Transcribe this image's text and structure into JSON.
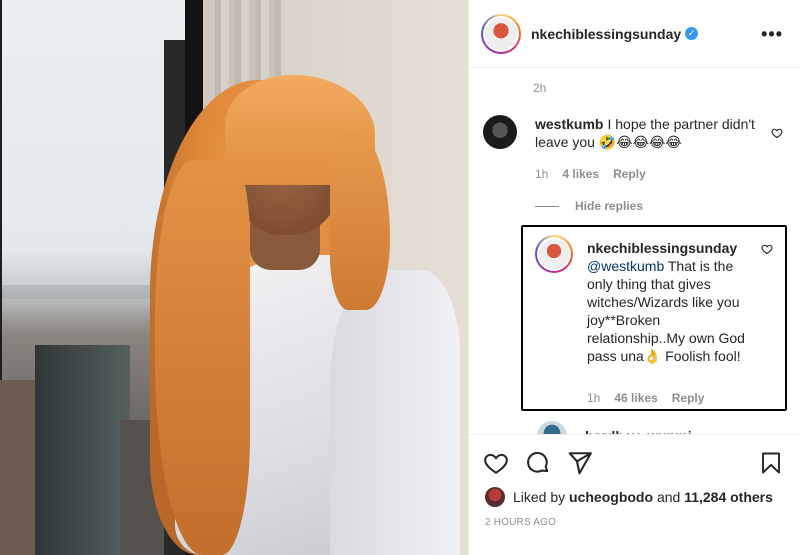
{
  "post": {
    "author": "nkechiblessingsunday",
    "verified_mark": "✓",
    "more_label": "•••",
    "top_time": "2h",
    "posted_ago": "2 HOURS AGO"
  },
  "comments": [
    {
      "user": "westkumb",
      "text": "I hope the partner didn't leave you 🤣😂😂😂😂",
      "time": "1h",
      "likes": "4 likes",
      "reply_label": "Reply"
    }
  ],
  "replies_toggle": "Hide replies",
  "reply": {
    "user": "nkechiblessingsunday",
    "mention": "@westkumb",
    "text": " That is the only thing that gives witches/Wizards like you joy**Broken relationship..My own God pass una👌 Foolish fool!",
    "time": "1h",
    "likes": "46 likes",
    "reply_label": "Reply"
  },
  "next_comment": {
    "user": "hardhev_wunmi"
  },
  "likes_summary": {
    "prefix": "Liked by ",
    "user": "ucheogbodo",
    "joiner": " and ",
    "others": "11,284 others"
  },
  "icons": {
    "like": "heart-icon",
    "comment": "comment-icon",
    "share": "send-icon",
    "save": "bookmark-icon"
  },
  "colors": {
    "mention": "#00376b",
    "muted": "#8e8e8e",
    "verified": "#3897f0"
  }
}
